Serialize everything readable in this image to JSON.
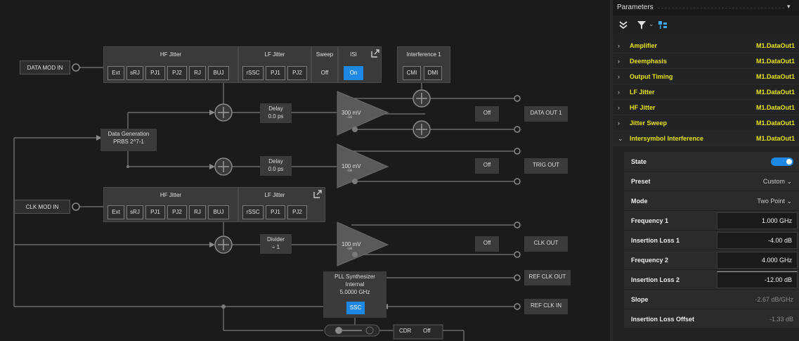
{
  "data_mod_in": "DATA MOD IN",
  "clk_mod_in": "CLK MOD IN",
  "hf_jitter_1": {
    "title": "HF Jitter",
    "buttons": [
      "Ext",
      "sRJ",
      "PJ1",
      "PJ2",
      "RJ",
      "BUJ"
    ]
  },
  "lf_jitter_1": {
    "title": "LF Jitter",
    "buttons": [
      "rSSC",
      "PJ1",
      "PJ2"
    ]
  },
  "sweep": {
    "title": "Sweep",
    "button": "Off"
  },
  "isi": {
    "title": "ISI",
    "button": "On"
  },
  "interference": {
    "title": "Interference 1",
    "buttons": [
      "CMI",
      "DMI"
    ]
  },
  "hf_jitter_2": {
    "title": "HF Jitter",
    "buttons": [
      "Ext",
      "sRJ",
      "PJ1",
      "PJ2",
      "RJ",
      "BUJ"
    ]
  },
  "lf_jitter_2": {
    "title": "LF Jitter",
    "buttons": [
      "rSSC",
      "PJ1",
      "PJ2"
    ]
  },
  "data_generation": {
    "title": "Data Generation",
    "value": "PRBS 2^7-1"
  },
  "delay_1": {
    "title": "Delay",
    "value": "0.0 ps"
  },
  "delay_2": {
    "title": "Delay",
    "value": "0.0 ps"
  },
  "divider": {
    "title": "Divider",
    "value": "÷ 1"
  },
  "amp_1": {
    "value": "300 mV",
    "sub": "-se"
  },
  "amp_2": {
    "value": "100 mV",
    "sub": "-se"
  },
  "amp_3": {
    "value": "100 mV",
    "sub": "-se"
  },
  "off_buttons": [
    "Off",
    "Off",
    "Off"
  ],
  "outputs": {
    "data_out": "DATA OUT 1",
    "trig_out": "TRIG OUT",
    "clk_out": "CLK OUT",
    "ref_clk_out": "REF CLK OUT",
    "ref_clk_in": "REF CLK IN"
  },
  "pll": {
    "title": "PLL Synthesizer",
    "mode": "Internal",
    "freq": "5.0000 GHz",
    "button": "SSC"
  },
  "cdr": {
    "label": "CDR",
    "value": "Off"
  },
  "panel": {
    "title": "Parameters",
    "groups": [
      {
        "name": "Amplifier",
        "value": "M1.DataOut1"
      },
      {
        "name": "Deemphasis",
        "value": "M1.DataOut1"
      },
      {
        "name": "Output Timing",
        "value": "M1.DataOut1"
      },
      {
        "name": "LF Jitter",
        "value": "M1.DataOut1"
      },
      {
        "name": "HF Jitter",
        "value": "M1.DataOut1"
      },
      {
        "name": "Jitter Sweep",
        "value": "M1.DataOut1"
      },
      {
        "name": "Intersymbol Interference",
        "value": "M1.DataOut1"
      }
    ],
    "params": {
      "state": "State",
      "preset": "Preset",
      "preset_value": "Custom",
      "mode": "Mode",
      "mode_value": "Two Point",
      "freq1": "Frequency 1",
      "freq1_value": "1.000 GHz",
      "loss1": "Insertion Loss 1",
      "loss1_value": "-4.00 dB",
      "freq2": "Frequency 2",
      "freq2_value": "4.000 GHz",
      "loss2": "Insertion Loss 2",
      "loss2_value": "-12.00 dB",
      "slope": "Slope",
      "slope_value": "-2.67 dB/GHz",
      "offset": "Insertion Loss Offset",
      "offset_value": "-1.33 dB"
    }
  },
  "colors": {
    "accent": "#1e88e5",
    "highlight": "#e6e61a"
  }
}
